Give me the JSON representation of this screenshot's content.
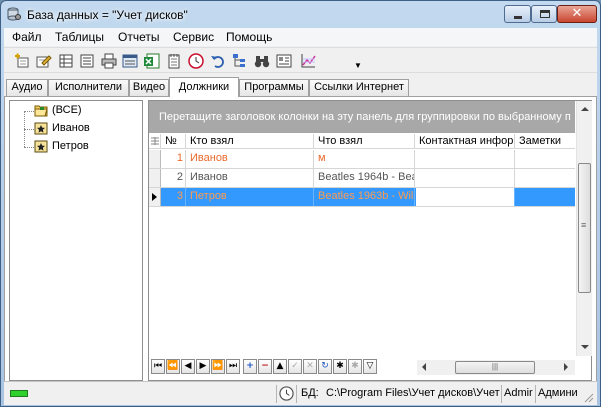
{
  "window": {
    "title": "База данных = \"Учет дисков\"",
    "icon": "database-gear-icon",
    "buttons": [
      "minimize-icon",
      "maximize-icon",
      "close-icon"
    ],
    "close_glyph": "✕"
  },
  "menu": [
    "Файл",
    "Таблицы",
    "Отчеты",
    "Сервис",
    "Помощь"
  ],
  "toolbar": {
    "icons": [
      "add-record-icon",
      "edit-icon",
      "table-icon",
      "list-icon",
      "print-icon",
      "print-preview-icon",
      "excel-export-icon",
      "notepad-icon",
      "clock-icon",
      "undo-icon",
      "tree-icon",
      "binoculars-icon",
      "card-icon",
      "chart-icon",
      "dropdown-arrow-icon"
    ],
    "dropdown_glyph": "▼"
  },
  "tabs": [
    {
      "label": "Аудио",
      "active": false
    },
    {
      "label": "Исполнители",
      "active": false
    },
    {
      "label": "Видео",
      "active": false
    },
    {
      "label": "Должники",
      "active": true
    },
    {
      "label": "Программы",
      "active": false
    },
    {
      "label": "Ссылки Интернет",
      "active": false
    }
  ],
  "tree": {
    "nodes": [
      {
        "label": "(ВСЕ)",
        "icon": "folder-open-icon"
      },
      {
        "label": "Иванов",
        "icon": "contact-card-icon"
      },
      {
        "label": "Петров",
        "icon": "contact-card-icon"
      }
    ]
  },
  "grid": {
    "group_panel_text": "Перетащите заголовок колонки на эту панель для группировки по выбранному п",
    "columns": [
      "№",
      "Кто взял",
      "Что взял",
      "Контактная инфор",
      "Заметки"
    ],
    "rows": [
      {
        "num": "1",
        "who": "Иванов",
        "what": "м",
        "contact": "",
        "notes": "",
        "selected": false
      },
      {
        "num": "2",
        "who": "Иванов",
        "what": "Beatles 1964b - Bea",
        "contact": "",
        "notes": "",
        "selected": false
      },
      {
        "num": "3",
        "who": "Петров",
        "what": "Beatles 1963b - Will",
        "contact": "",
        "notes": "",
        "selected": true
      }
    ],
    "navigator": [
      "first-record-icon",
      "prior-page-icon",
      "prior-record-icon",
      "next-record-icon",
      "next-page-icon",
      "last-record-icon",
      "insert-icon",
      "delete-icon",
      "edit-icon",
      "post-icon",
      "cancel-icon",
      "refresh-icon",
      "bookmark-icon",
      "filter-icon"
    ],
    "nav_glyphs": [
      "⏮",
      "⏪",
      "◀",
      "▶",
      "⏩",
      "⏭",
      "+",
      "−",
      "▲",
      "✓",
      "✕",
      "↻",
      "✱",
      "▽"
    ],
    "hscroll_grip": "|||",
    "vscroll_grip": "≡"
  },
  "status": {
    "db_label": "БД:",
    "db_path": "C:\\Program Files\\Учет дисков\\Учет",
    "user1": "Admir",
    "user2": "Админи",
    "clock_icon": "clock-icon",
    "led_color": "#2fd12f"
  }
}
